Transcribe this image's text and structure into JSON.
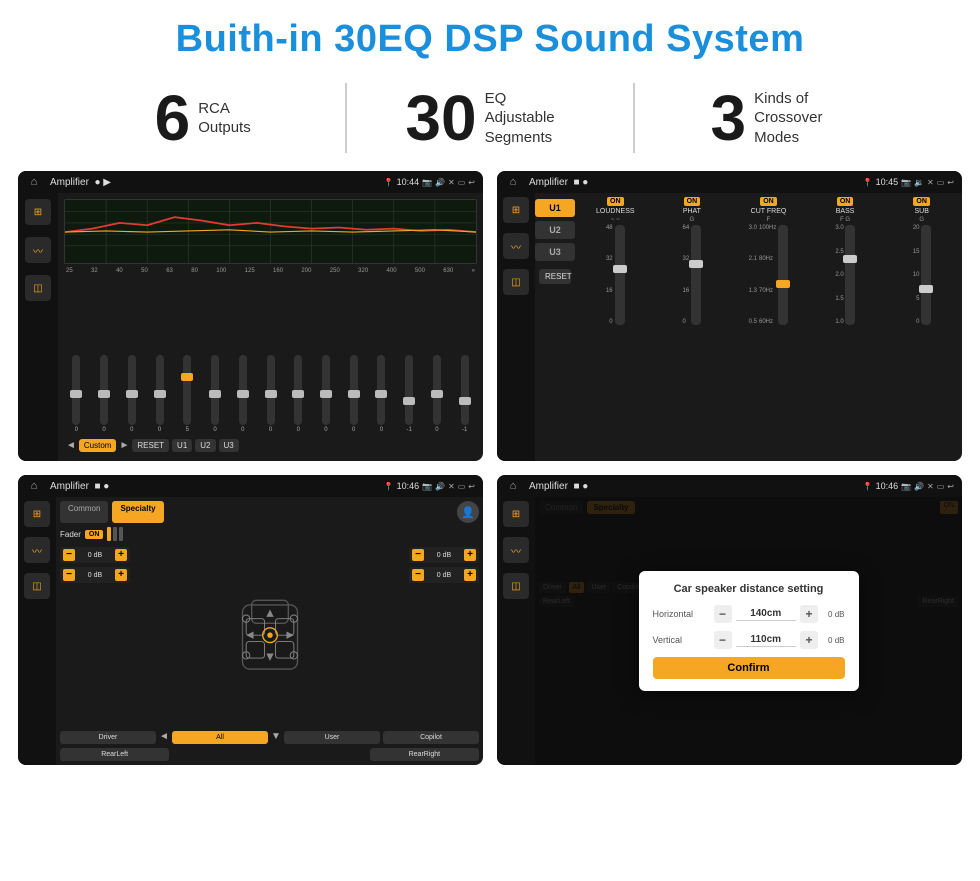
{
  "page": {
    "title": "Buith-in 30EQ DSP Sound System"
  },
  "stats": [
    {
      "number": "6",
      "label_line1": "RCA",
      "label_line2": "Outputs"
    },
    {
      "number": "30",
      "label_line1": "EQ Adjustable",
      "label_line2": "Segments"
    },
    {
      "number": "3",
      "label_line1": "Kinds of",
      "label_line2": "Crossover Modes"
    }
  ],
  "screens": [
    {
      "id": "eq-screen",
      "status_title": "Amplifier",
      "status_time": "10:44",
      "type": "eq"
    },
    {
      "id": "amp-screen",
      "status_title": "Amplifier",
      "status_time": "10:45",
      "type": "amp"
    },
    {
      "id": "speaker-screen",
      "status_title": "Amplifier",
      "status_time": "10:46",
      "type": "speaker"
    },
    {
      "id": "distance-screen",
      "status_title": "Amplifier",
      "status_time": "10:46",
      "type": "distance"
    }
  ],
  "eq": {
    "freqs": [
      "25",
      "32",
      "40",
      "50",
      "63",
      "80",
      "100",
      "125",
      "160",
      "200",
      "250",
      "320",
      "400",
      "500",
      "630"
    ],
    "values": [
      "0",
      "0",
      "0",
      "0",
      "5",
      "0",
      "0",
      "0",
      "0",
      "0",
      "0",
      "0",
      "-1",
      "0",
      "-1"
    ],
    "preset": "Custom",
    "buttons": [
      "RESET",
      "U1",
      "U2",
      "U3"
    ]
  },
  "amp": {
    "u_buttons": [
      "U1",
      "U2",
      "U3"
    ],
    "bands": [
      {
        "label": "LOUDNESS",
        "on": true
      },
      {
        "label": "PHAT",
        "on": true
      },
      {
        "label": "CUT FREQ",
        "on": true
      },
      {
        "label": "BASS",
        "on": true
      },
      {
        "label": "SUB",
        "on": true
      }
    ]
  },
  "speaker": {
    "tabs": [
      "Common",
      "Specialty"
    ],
    "fader_label": "Fader",
    "fader_on": "ON",
    "db_values": [
      "0 dB",
      "0 dB",
      "0 dB",
      "0 dB"
    ],
    "buttons": [
      "Driver",
      "Copilot",
      "RearLeft",
      "All",
      "User",
      "RearRight"
    ]
  },
  "distance": {
    "modal_title": "Car speaker distance setting",
    "horizontal_label": "Horizontal",
    "horizontal_value": "140cm",
    "vertical_label": "Vertical",
    "vertical_value": "110cm",
    "confirm_label": "Confirm",
    "db_right_values": [
      "0 dB",
      "0 dB"
    ]
  }
}
